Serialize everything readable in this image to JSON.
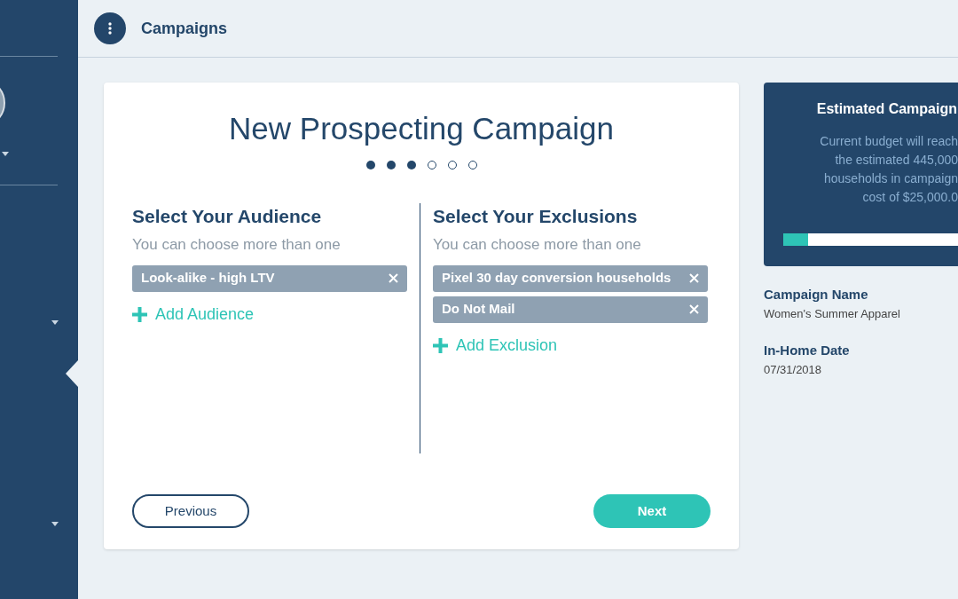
{
  "header": {
    "title": "Campaigns"
  },
  "wizard": {
    "title": "New Prospecting Campaign",
    "steps": [
      {
        "done": true
      },
      {
        "done": true
      },
      {
        "done": true
      },
      {
        "done": false
      },
      {
        "done": false
      },
      {
        "done": false
      }
    ],
    "audience": {
      "heading": "Select Your Audience",
      "hint": "You can choose more than one",
      "tags": [
        "Look-alike - high LTV"
      ],
      "add": "Add Audience"
    },
    "exclusions": {
      "heading": "Select Your Exclusions",
      "hint": "You can choose more than one",
      "tags": [
        "Pixel 30 day conversion households",
        "Do Not Mail"
      ],
      "add": "Add Exclusion"
    },
    "buttons": {
      "previous": "Previous",
      "next": "Next"
    }
  },
  "estimate": {
    "title": "Estimated Campaign",
    "lines": [
      "Current budget will reach",
      "the estimated 445,000",
      "households in campaign",
      "cost of $25,000.0"
    ],
    "level": 0.14
  },
  "details": [
    {
      "label": "Campaign Name",
      "value": "Women's Summer Apparel"
    },
    {
      "label": "In-Home Date",
      "value": "07/31/2018"
    }
  ]
}
